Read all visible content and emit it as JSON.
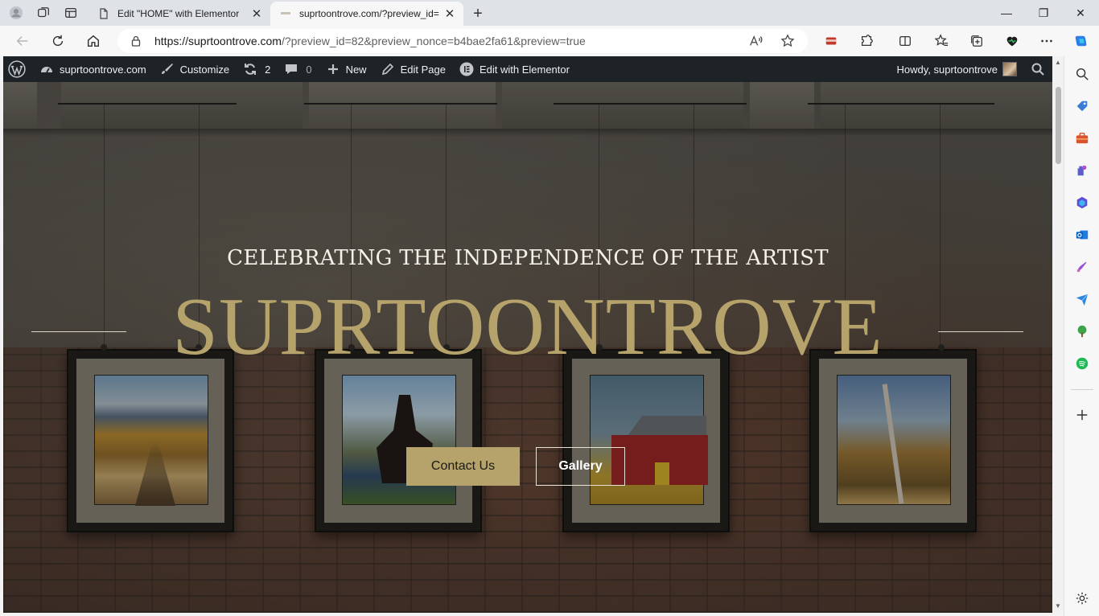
{
  "browser": {
    "tabs": [
      {
        "title": "Edit \"HOME\" with Elementor",
        "active": false
      },
      {
        "title": "suprtoontrove.com/?preview_id=",
        "active": true
      }
    ],
    "address": {
      "host": "https://suprtoontrove.com",
      "path": "/?preview_id=82&preview_nonce=b4bae2fa61&preview=true"
    }
  },
  "adminbar": {
    "site_name": "suprtoontrove.com",
    "customize": "Customize",
    "updates_count": "2",
    "comments_count": "0",
    "new_label": "New",
    "edit_page": "Edit Page",
    "edit_elementor": "Edit with Elementor",
    "howdy": "Howdy, suprtoontrove"
  },
  "hero": {
    "subtitle": "CELEBRATING THE INDEPENDENCE OF THE ARTIST",
    "title": "SUPRTOONTROVE",
    "contact_label": "Contact Us",
    "gallery_label": "Gallery"
  },
  "colors": {
    "accent_gold": "#b5a36b",
    "adminbar_bg": "#1d2327"
  },
  "sidebar_icons": [
    "search-icon",
    "tag-icon",
    "briefcase-icon",
    "games-icon",
    "copilot-icon",
    "outlook-icon",
    "designer-icon",
    "send-icon",
    "tree-icon",
    "spotify-icon",
    "add-icon",
    "settings-icon"
  ]
}
